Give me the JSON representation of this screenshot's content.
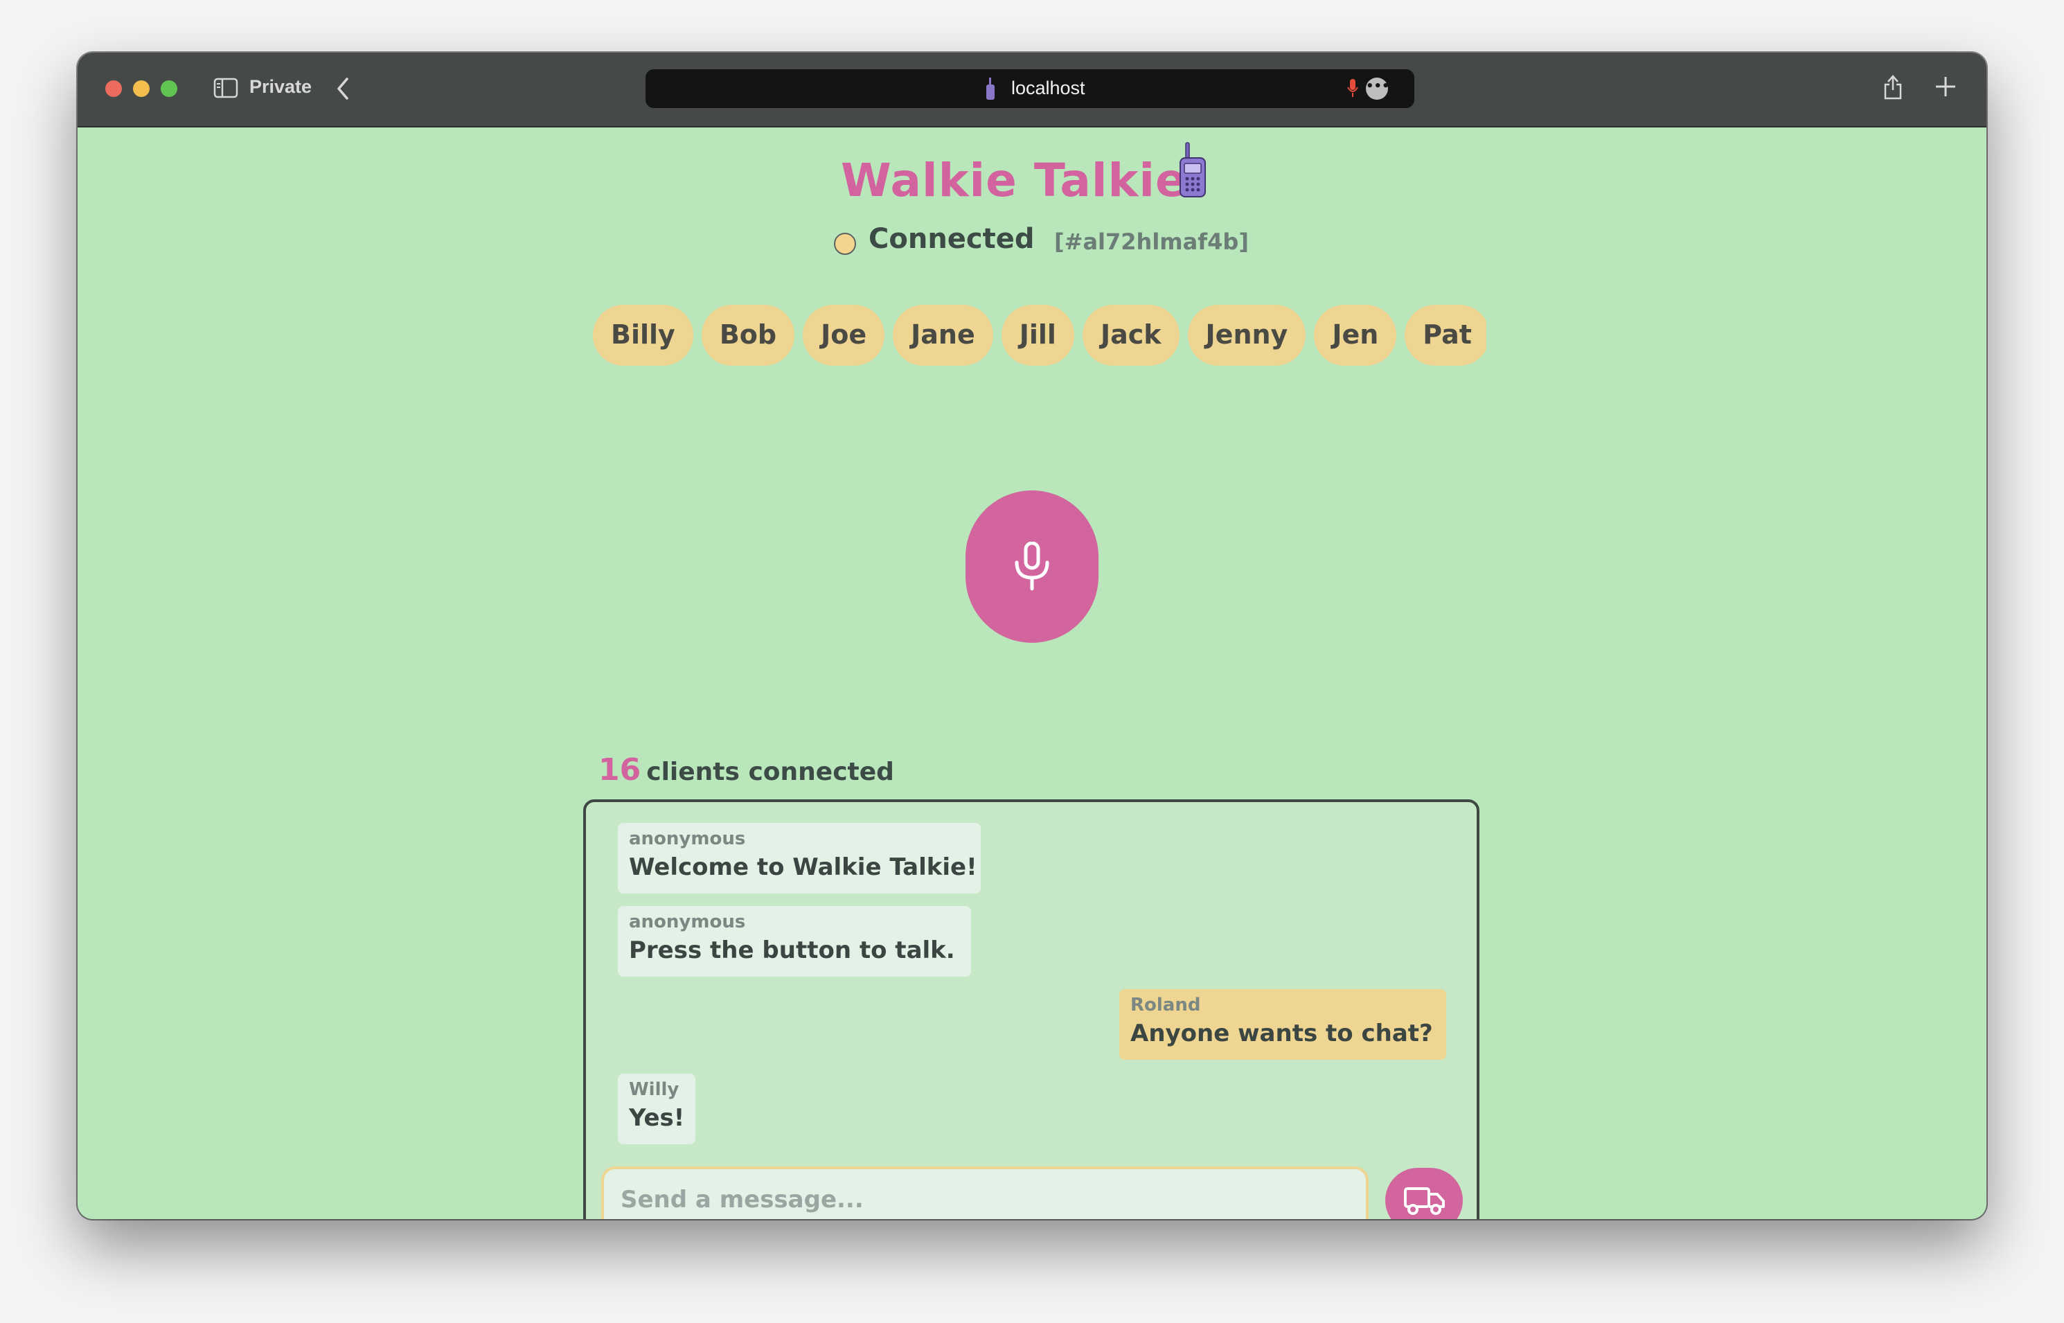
{
  "browser": {
    "private_label": "Private",
    "url": "localhost"
  },
  "app": {
    "title": "Walkie Talkie",
    "status": "Connected",
    "session_id": "[#al72hlmaf4b]"
  },
  "users": [
    "Billy",
    "Bob",
    "Joe",
    "Jane",
    "Jill",
    "Jack",
    "Jenny",
    "Jen",
    "Pat"
  ],
  "clients": {
    "count": "16",
    "label": "clients connected"
  },
  "messages": [
    {
      "author": "anonymous",
      "text": "Welcome to Walkie Talkie!",
      "mine": false
    },
    {
      "author": "anonymous",
      "text": "Press the button to talk.",
      "mine": false
    },
    {
      "author": "Roland",
      "text": "Anyone wants to chat?",
      "mine": true
    },
    {
      "author": "Willy",
      "text": "Yes!",
      "mine": false
    }
  ],
  "composer": {
    "placeholder": "Send a message...",
    "value": ""
  },
  "colors": {
    "background": "#b9e6bb",
    "accent_pink": "#d3659e",
    "chip_yellow": "#efd592",
    "text_dark": "#3d4b47"
  },
  "icons": {
    "walkie": "walkie-talkie-icon",
    "mic": "microphone-icon",
    "send": "truck-icon"
  }
}
